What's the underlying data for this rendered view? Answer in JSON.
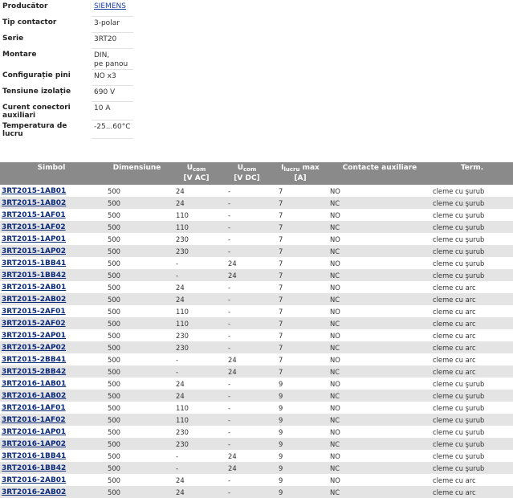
{
  "specs": [
    {
      "label": "Producător",
      "value": "SIEMENS",
      "link": true
    },
    {
      "label": "Tip contactor",
      "value": "3-polar"
    },
    {
      "label": "Serie",
      "value": "3RT20"
    },
    {
      "label": "Montare",
      "value": "DIN,",
      "value2": "pe panou"
    },
    {
      "label": "Configurație pini",
      "value": "NO x3"
    },
    {
      "label": "Tensiune izolație",
      "value": "690 V"
    },
    {
      "label": "Curent conectori auxiliari",
      "value": "10 A"
    },
    {
      "label": "Temperatura de lucru",
      "value": "-25...60°C"
    }
  ],
  "table": {
    "headers": {
      "symbol": "Simbol",
      "dimension": "Dimensiune",
      "ucom_ac_main": "U",
      "ucom_ac_sub": "com",
      "ucom_ac_unit": "[V AC]",
      "ucom_dc_main": "U",
      "ucom_dc_sub": "com",
      "ucom_dc_unit": "[V DC]",
      "ilucru_main": "I",
      "ilucru_sub": "lucru",
      "ilucru_suffix": " max",
      "ilucru_unit": "[A]",
      "aux": "Contacte auxiliare",
      "term": "Term."
    },
    "rows": [
      [
        "3RT2015-1AB01",
        "500",
        "24",
        "-",
        "7",
        "NO",
        "cleme cu şurub"
      ],
      [
        "3RT2015-1AB02",
        "500",
        "24",
        "-",
        "7",
        "NC",
        "cleme cu şurub"
      ],
      [
        "3RT2015-1AF01",
        "500",
        "110",
        "-",
        "7",
        "NO",
        "cleme cu şurub"
      ],
      [
        "3RT2015-1AF02",
        "500",
        "110",
        "-",
        "7",
        "NC",
        "cleme cu şurub"
      ],
      [
        "3RT2015-1AP01",
        "500",
        "230",
        "-",
        "7",
        "NO",
        "cleme cu şurub"
      ],
      [
        "3RT2015-1AP02",
        "500",
        "230",
        "-",
        "7",
        "NC",
        "cleme cu şurub"
      ],
      [
        "3RT2015-1BB41",
        "500",
        "-",
        "24",
        "7",
        "NO",
        "cleme cu şurub"
      ],
      [
        "3RT2015-1BB42",
        "500",
        "-",
        "24",
        "7",
        "NC",
        "cleme cu şurub"
      ],
      [
        "3RT2015-2AB01",
        "500",
        "24",
        "-",
        "7",
        "NO",
        "cleme cu arc"
      ],
      [
        "3RT2015-2AB02",
        "500",
        "24",
        "-",
        "7",
        "NC",
        "cleme cu arc"
      ],
      [
        "3RT2015-2AF01",
        "500",
        "110",
        "-",
        "7",
        "NO",
        "cleme cu arc"
      ],
      [
        "3RT2015-2AF02",
        "500",
        "110",
        "-",
        "7",
        "NC",
        "cleme cu arc"
      ],
      [
        "3RT2015-2AP01",
        "500",
        "230",
        "-",
        "7",
        "NO",
        "cleme cu arc"
      ],
      [
        "3RT2015-2AP02",
        "500",
        "230",
        "-",
        "7",
        "NC",
        "cleme cu arc"
      ],
      [
        "3RT2015-2BB41",
        "500",
        "-",
        "24",
        "7",
        "NO",
        "cleme cu arc"
      ],
      [
        "3RT2015-2BB42",
        "500",
        "-",
        "24",
        "7",
        "NC",
        "cleme cu arc"
      ],
      [
        "3RT2016-1AB01",
        "500",
        "24",
        "-",
        "9",
        "NO",
        "cleme cu şurub"
      ],
      [
        "3RT2016-1AB02",
        "500",
        "24",
        "-",
        "9",
        "NC",
        "cleme cu şurub"
      ],
      [
        "3RT2016-1AF01",
        "500",
        "110",
        "-",
        "9",
        "NO",
        "cleme cu şurub"
      ],
      [
        "3RT2016-1AF02",
        "500",
        "110",
        "-",
        "9",
        "NC",
        "cleme cu şurub"
      ],
      [
        "3RT2016-1AP01",
        "500",
        "230",
        "-",
        "9",
        "NO",
        "cleme cu şurub"
      ],
      [
        "3RT2016-1AP02",
        "500",
        "230",
        "-",
        "9",
        "NC",
        "cleme cu şurub"
      ],
      [
        "3RT2016-1BB41",
        "500",
        "-",
        "24",
        "9",
        "NO",
        "cleme cu şurub"
      ],
      [
        "3RT2016-1BB42",
        "500",
        "-",
        "24",
        "9",
        "NC",
        "cleme cu şurub"
      ],
      [
        "3RT2016-2AB01",
        "500",
        "24",
        "-",
        "9",
        "NO",
        "cleme cu arc"
      ],
      [
        "3RT2016-2AB02",
        "500",
        "24",
        "-",
        "9",
        "NC",
        "cleme cu arc"
      ]
    ]
  }
}
